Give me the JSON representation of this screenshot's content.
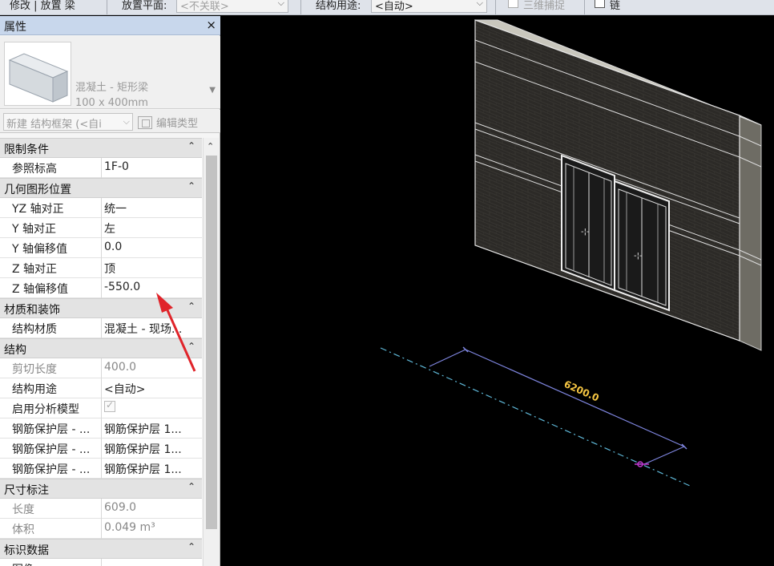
{
  "options_bar": {
    "context": "修改 | 放置 梁",
    "placement_plane_label": "放置平面:",
    "placement_plane_value": "<不关联>",
    "structural_usage_label": "结构用途:",
    "structural_usage_value": "<自动>",
    "snap_3d_label": "三维捕捉",
    "chain_label": "链"
  },
  "properties": {
    "title": "属性",
    "close_glyph": "×",
    "type_line1": "混凝土 - 矩形梁",
    "type_line2": "100 x 400mm",
    "filter_value": "新建 结构框架 (<自i",
    "edit_type_label": "编辑类型",
    "sections": [
      {
        "label": "限制条件",
        "rows": [
          {
            "key": "参照标高",
            "value": "1F-0"
          }
        ]
      },
      {
        "label": "几何图形位置",
        "rows": [
          {
            "key": "YZ 轴对正",
            "value": "统一"
          },
          {
            "key": "Y 轴对正",
            "value": "左"
          },
          {
            "key": "Y 轴偏移值",
            "value": "0.0"
          },
          {
            "key": "Z 轴对正",
            "value": "顶"
          },
          {
            "key": "Z 轴偏移值",
            "value": "-550.0"
          }
        ]
      },
      {
        "label": "材质和装饰",
        "rows": [
          {
            "key": "结构材质",
            "value": "混凝土 - 现场..."
          }
        ]
      },
      {
        "label": "结构",
        "rows": [
          {
            "key": "剪切长度",
            "value": "400.0",
            "disabled": true
          },
          {
            "key": "结构用途",
            "value": "<自动>"
          },
          {
            "key": "启用分析模型",
            "value": "",
            "checkbox": true
          },
          {
            "key": "钢筋保护层 - ...",
            "value": "钢筋保护层 1..."
          },
          {
            "key": "钢筋保护层 - ...",
            "value": "钢筋保护层 1..."
          },
          {
            "key": "钢筋保护层 - ...",
            "value": "钢筋保护层 1..."
          }
        ]
      },
      {
        "label": "尺寸标注",
        "rows": [
          {
            "key": "长度",
            "value": "609.0",
            "disabled": true
          },
          {
            "key": "体积",
            "value": "0.049 m³",
            "disabled": true
          }
        ]
      },
      {
        "label": "标识数据",
        "rows": [
          {
            "key": "图像",
            "value": ""
          }
        ]
      }
    ],
    "collapse_glyph": "⌃"
  },
  "viewport": {
    "dimension_text": "6200.0"
  },
  "colors": {
    "dimension_text": "#f5c542",
    "beam_line": "#7f86e0",
    "annotation_arrow": "#e0242a",
    "reference_line": "#5fb8d8"
  }
}
